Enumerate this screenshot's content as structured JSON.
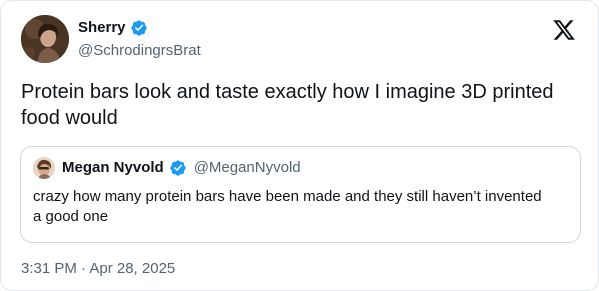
{
  "author": {
    "display_name": "Sherry",
    "handle": "@SchrodingrsBrat",
    "avatar_icon": "profile-photo-avatar",
    "verified_icon": "verified-badge-icon"
  },
  "brand": {
    "logo_icon": "x-logo-icon"
  },
  "tweet": {
    "text": "Protein bars look and taste exactly how I imagine 3D printed food would",
    "timestamp": "3:31 PM · Apr 28, 2025"
  },
  "quoted_tweet": {
    "display_name": "Megan Nyvold",
    "handle": "@MeganNyvold",
    "text": "crazy how many protein bars have been made and they still haven’t invented a good one",
    "avatar_icon": "profile-photo-avatar",
    "verified_icon": "verified-badge-icon"
  },
  "colors": {
    "text_primary": "#0f1419",
    "text_secondary": "#536471",
    "verified_blue": "#1d9bf0",
    "border": "#cfd9de"
  }
}
